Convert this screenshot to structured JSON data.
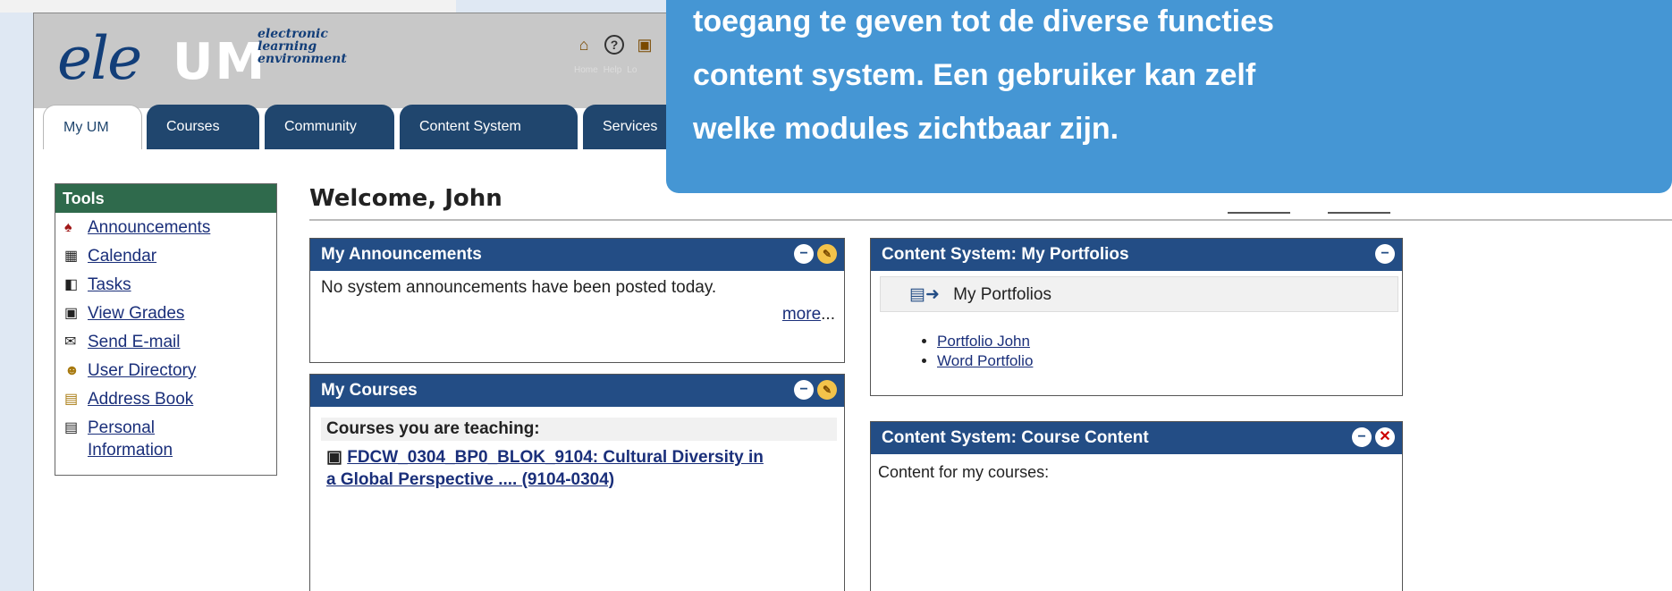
{
  "header": {
    "logo_ele": "ele",
    "logo_um": "UM",
    "logo_sub": [
      "electronic",
      "learning",
      "environment"
    ],
    "icons": [
      {
        "name": "home-icon",
        "glyph": "🏠",
        "label": "Home"
      },
      {
        "name": "help-icon",
        "glyph": "?",
        "label": "Help"
      },
      {
        "name": "logout-icon",
        "glyph": "🚪",
        "label": "Lo"
      }
    ]
  },
  "tabs": [
    "My UM",
    "Courses",
    "Community",
    "Content System",
    "Services"
  ],
  "callout": {
    "lines": [
      "toegang te geven tot de diverse functies",
      "content system. Een gebruiker kan zelf",
      "welke modules zichtbaar zijn."
    ]
  },
  "tools": {
    "title": "Tools",
    "items": [
      {
        "label": "Announcements",
        "icon": "megaphone-icon"
      },
      {
        "label": "Calendar",
        "icon": "calendar-icon"
      },
      {
        "label": "Tasks",
        "icon": "tasks-icon"
      },
      {
        "label": "View Grades",
        "icon": "grades-icon"
      },
      {
        "label": "Send E-mail",
        "icon": "mail-icon"
      },
      {
        "label": "User Directory",
        "icon": "users-icon"
      },
      {
        "label": "Address Book",
        "icon": "address-book-icon"
      },
      {
        "label": "Personal Information",
        "icon": "id-card-icon",
        "line2": "Information",
        "line1": "Personal"
      }
    ]
  },
  "welcome": "Welcome, John",
  "announcements": {
    "title": "My Announcements",
    "text": "No system announcements have been posted today.",
    "more": "more",
    "more_suffix": "..."
  },
  "courses": {
    "title": "My Courses",
    "teaching_heading": "Courses you are teaching:",
    "course_line1": "FDCW_0304_BP0_BLOK_9104: Cultural Diversity in",
    "course_line2": "a Global Perspective .... (9104-0304)"
  },
  "portfolios": {
    "title": "Content System: My Portfolios",
    "heading": "My Portfolios",
    "items": [
      "Portfolio John",
      "Word Portfolio"
    ]
  },
  "course_content": {
    "title": "Content System: Course Content",
    "text": "Content for my courses:"
  }
}
